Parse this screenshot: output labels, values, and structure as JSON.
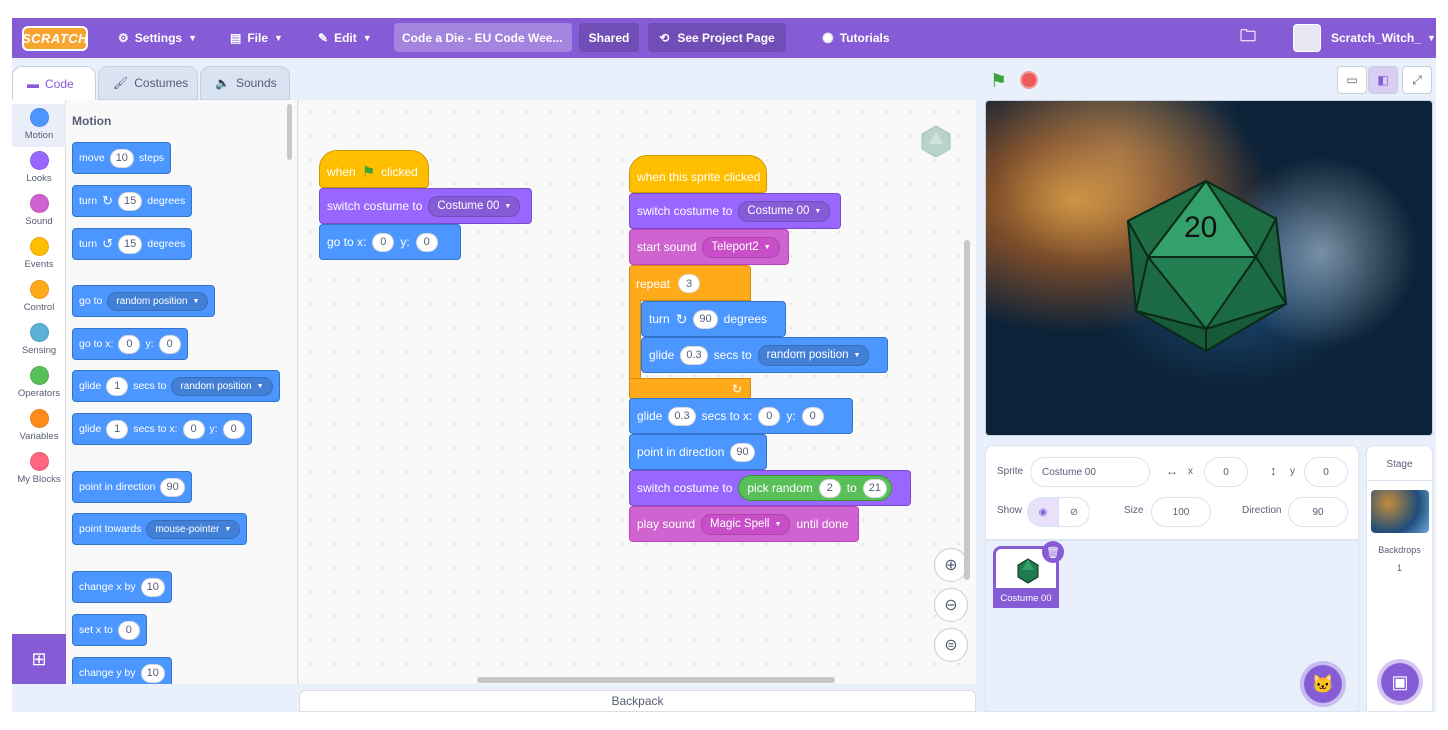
{
  "menu": {
    "logo": "SCRATCH",
    "settings": "Settings",
    "file": "File",
    "edit": "Edit",
    "project_title": "Code a Die - EU Code Wee...",
    "shared": "Shared",
    "see_project": "See Project Page",
    "tutorials": "Tutorials",
    "username": "Scratch_Witch_"
  },
  "tabs": {
    "code": "Code",
    "costumes": "Costumes",
    "sounds": "Sounds"
  },
  "categories": [
    "Motion",
    "Looks",
    "Sound",
    "Events",
    "Control",
    "Sensing",
    "Operators",
    "Variables",
    "My Blocks"
  ],
  "category_colors": [
    "#4c97ff",
    "#9966ff",
    "#cf63cf",
    "#ffbf00",
    "#ffab19",
    "#5cb1d6",
    "#59c059",
    "#ff8c1a",
    "#ff6680"
  ],
  "palette": {
    "heading": "Motion",
    "move": {
      "a": "move",
      "n": "10",
      "b": "steps"
    },
    "turn_right": {
      "a": "turn",
      "n": "15",
      "b": "degrees"
    },
    "turn_left": {
      "a": "turn",
      "n": "15",
      "b": "degrees"
    },
    "goto": {
      "a": "go to",
      "dd": "random position"
    },
    "gotoxy": {
      "a": "go to x:",
      "x": "0",
      "y_label": "y:",
      "y": "0"
    },
    "glide_to": {
      "a": "glide",
      "n": "1",
      "b": "secs to",
      "dd": "random position"
    },
    "glide_xy": {
      "a": "glide",
      "n": "1",
      "b": "secs to x:",
      "x": "0",
      "y_label": "y:",
      "y": "0"
    },
    "point_dir": {
      "a": "point in direction",
      "n": "90"
    },
    "point_towards": {
      "a": "point towards",
      "dd": "mouse-pointer"
    },
    "change_x": {
      "a": "change x by",
      "n": "10"
    },
    "set_x": {
      "a": "set x to",
      "n": "0"
    },
    "change_y": {
      "a": "change y by",
      "n": "10"
    }
  },
  "script1": {
    "hat_a": "when",
    "hat_b": "clicked",
    "switch": {
      "a": "switch costume to",
      "dd": "Costume 00"
    },
    "goto": {
      "a": "go to x:",
      "x": "0",
      "y_label": "y:",
      "y": "0"
    }
  },
  "script2": {
    "hat": "when this sprite clicked",
    "switch1": {
      "a": "switch costume to",
      "dd": "Costume 00"
    },
    "sound": {
      "a": "start sound",
      "dd": "Teleport2"
    },
    "repeat": {
      "a": "repeat",
      "n": "3"
    },
    "turn": {
      "a": "turn",
      "n": "90",
      "b": "degrees"
    },
    "glide": {
      "a": "glide",
      "n": "0.3",
      "b": "secs to",
      "dd": "random position"
    },
    "glide_xy": {
      "a": "glide",
      "n": "0.3",
      "b": "secs to x:",
      "x": "0",
      "y_label": "y:",
      "y": "0"
    },
    "point": {
      "a": "point in direction",
      "n": "90"
    },
    "switch2": {
      "a": "switch costume to",
      "op_a": "pick random",
      "op_from": "2",
      "op_to_label": "to",
      "op_to": "21"
    },
    "play": {
      "a": "play sound",
      "dd": "Magic Spell",
      "b": "until done"
    }
  },
  "zoom": {
    "in": "+",
    "out": "−",
    "reset": "="
  },
  "backpack": "Backpack",
  "stage_die_number": "20",
  "sprite_info": {
    "sprite_label": "Sprite",
    "sprite_name": "Costume 00",
    "x_label": "x",
    "x": "0",
    "y_label": "y",
    "y": "0",
    "show_label": "Show",
    "size_label": "Size",
    "size": "100",
    "direction_label": "Direction",
    "direction": "90"
  },
  "sprite_thumb_label": "Costume 00",
  "stage_panel": {
    "title": "Stage",
    "backdrops_label": "Backdrops",
    "backdrops_count": "1"
  }
}
